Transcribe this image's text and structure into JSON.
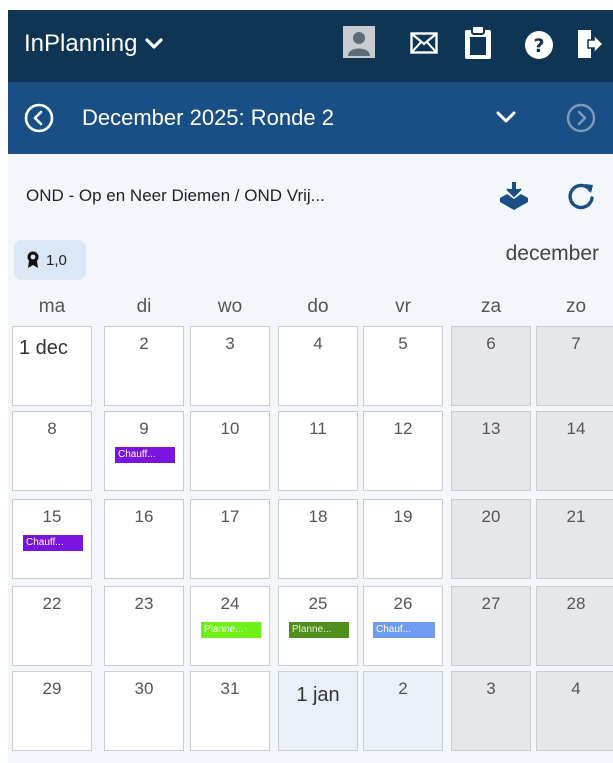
{
  "app": {
    "name": "InPlanning",
    "icons": [
      "avatar-icon",
      "mail-icon",
      "clipboard-icon",
      "help-icon",
      "logout-icon"
    ]
  },
  "nav": {
    "title": "December 2025: Ronde 2"
  },
  "toolbar": {
    "organization": "OND - Op en Neer Diemen / OND Vrij..."
  },
  "badge": {
    "value": "1,0"
  },
  "calendar": {
    "month_label": "december",
    "weekdays": [
      "ma",
      "di",
      "wo",
      "do",
      "vr",
      "za",
      "zo"
    ],
    "weeks": [
      [
        "1 dec",
        "2",
        "3",
        "4",
        "5",
        "6",
        "7"
      ],
      [
        "8",
        "9",
        "10",
        "11",
        "12",
        "13",
        "14"
      ],
      [
        "15",
        "16",
        "17",
        "18",
        "19",
        "20",
        "21"
      ],
      [
        "22",
        "23",
        "24",
        "25",
        "26",
        "27",
        "28"
      ],
      [
        "29",
        "30",
        "31",
        "1 jan",
        "2",
        "3",
        "4"
      ]
    ],
    "events": {
      "w1d1": "Chauff...",
      "w2d0": "Chauff...",
      "w3d2": "Planne...",
      "w3d3": "Planne...",
      "w3d4": "Chauf..."
    }
  },
  "colors": {
    "topbar": "#0f3555",
    "navbar": "#1a4f86",
    "event_purple": "#7a12e0",
    "event_green": "#6ef01a",
    "event_olive": "#4f8f1c",
    "event_blue": "#6f9cf0",
    "weekend_bg": "#e5e7ea"
  }
}
